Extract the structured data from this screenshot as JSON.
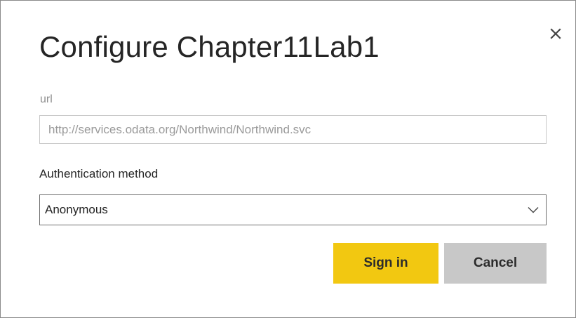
{
  "dialog": {
    "title": "Configure Chapter11Lab1",
    "close_icon": "close-icon"
  },
  "url_field": {
    "label": "url",
    "placeholder": "http://services.odata.org/Northwind/Northwind.svc"
  },
  "auth": {
    "label": "Authentication method",
    "selected": "Anonymous",
    "chevron_icon": "chevron-down-icon"
  },
  "buttons": {
    "sign_in": "Sign in",
    "cancel": "Cancel"
  },
  "colors": {
    "primary": "#f2c811",
    "secondary": "#c8c8c8",
    "border": "#8a8a8a"
  }
}
